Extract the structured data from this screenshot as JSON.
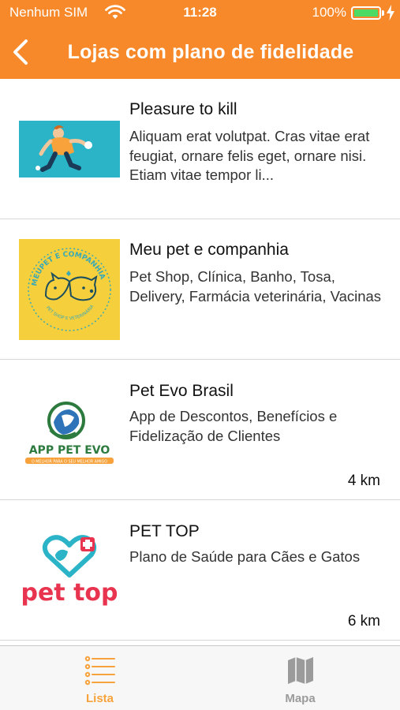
{
  "status_bar": {
    "carrier": "Nenhum SIM",
    "time": "11:28",
    "battery_percent": "100%",
    "battery_level": 1.0
  },
  "nav": {
    "title": "Lojas com plano de fidelidade",
    "back_icon": "chevron-left-icon"
  },
  "stores": [
    {
      "name": "Pleasure to kill",
      "description": "Aliquam erat volutpat. Cras vitae erat feugiat, ornare felis eget, ornare nisi. Etiam vitae tempor li...",
      "distance": ""
    },
    {
      "name": "Meu pet e companhia",
      "description": "Pet Shop, Clínica, Banho, Tosa, Delivery, Farmácia veterinária, Vacinas",
      "distance": "",
      "logo_text_top": "MEUPET E COMPANHIA",
      "logo_text_bottom": "PET SHOP E VETERINÁRIA"
    },
    {
      "name": "Pet Evo Brasil",
      "description": "App de Descontos, Benefícios e Fidelização de Clientes",
      "distance": "4 km",
      "logo_text": "APP PET EVO",
      "logo_subtext": "O MELHOR PARA O SEU MELHOR AMIGO"
    },
    {
      "name": "PET TOP",
      "description": "Plano de Saúde para Cães e Gatos",
      "distance": "6 km",
      "logo_text": "pet top"
    }
  ],
  "tabs": [
    {
      "label": "Lista",
      "icon": "list-icon",
      "active": true
    },
    {
      "label": "Mapa",
      "icon": "map-icon",
      "active": false
    }
  ],
  "colors": {
    "brand": "#f7892a",
    "tab_active": "#f7a23a",
    "tab_inactive": "#9b9b9b",
    "battery": "#4cd964"
  }
}
